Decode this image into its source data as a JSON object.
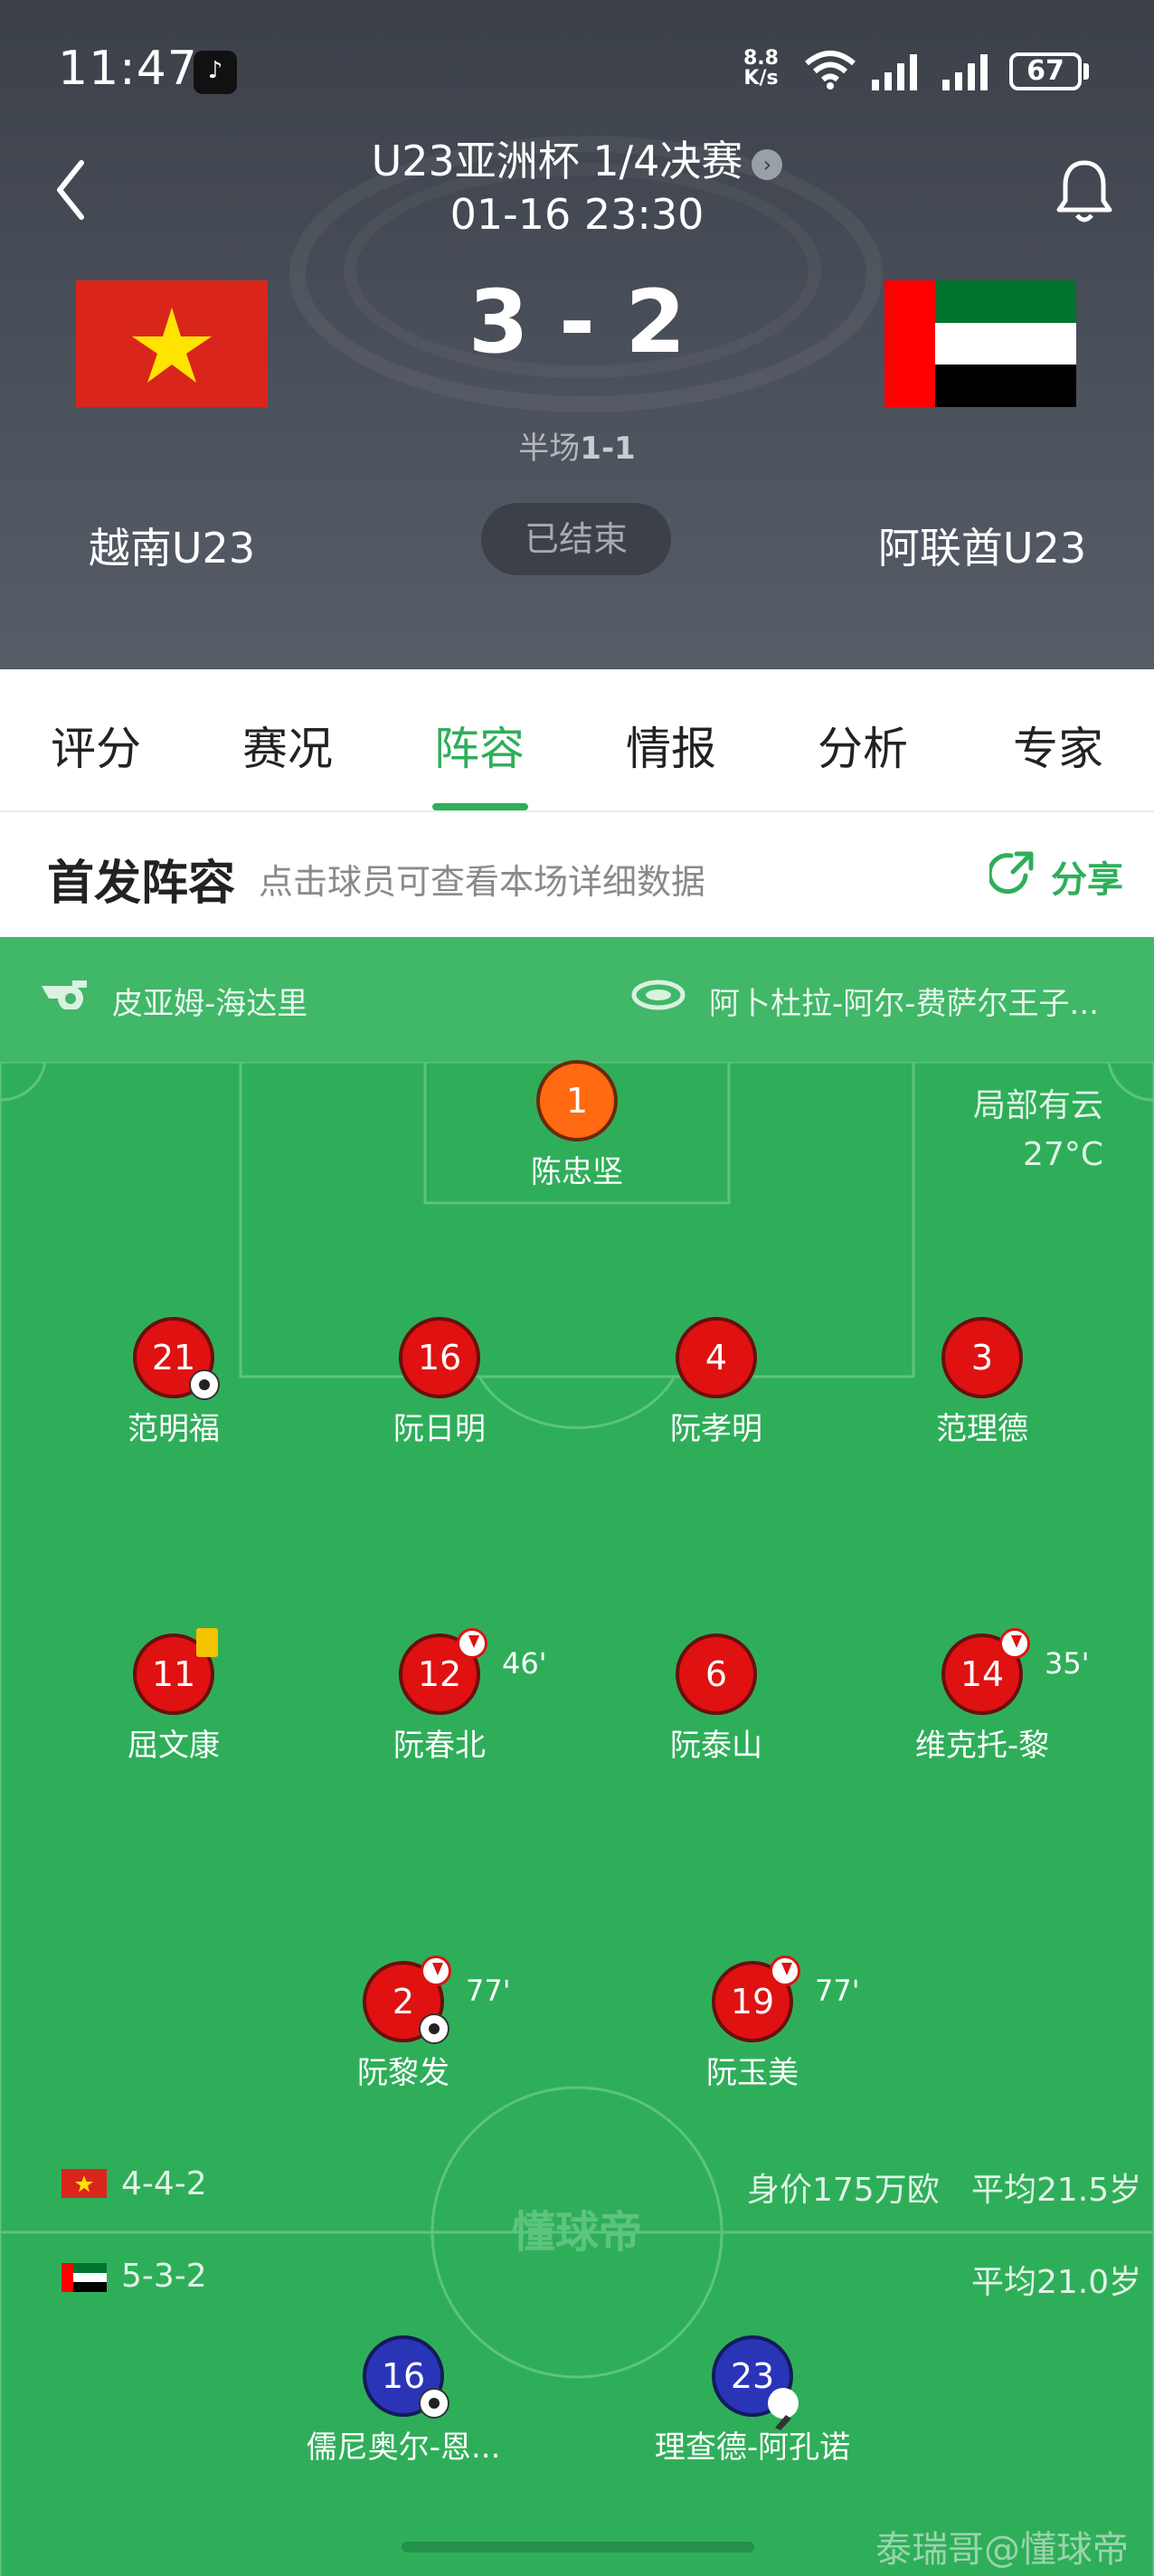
{
  "status_bar": {
    "time": "11:47",
    "net_speed": "8.8",
    "net_unit": "K/s",
    "battery": "67"
  },
  "header": {
    "title": "U23亚洲杯 1/4决赛",
    "datetime": "01-16 23:30",
    "score": "3 - 2",
    "halftime_label": "半场",
    "halftime_score": "1-1",
    "status": "已结束",
    "home_team": "越南U23",
    "away_team": "阿联酋U23"
  },
  "tabs": [
    {
      "label": "评分"
    },
    {
      "label": "赛况"
    },
    {
      "label": "阵容",
      "active": true
    },
    {
      "label": "情报"
    },
    {
      "label": "分析"
    },
    {
      "label": "专家"
    }
  ],
  "lineup": {
    "title": "首发阵容",
    "hint": "点击球员可查看本场详细数据",
    "share_label": "分享",
    "referee": "皮亚姆-海达里",
    "stadium": "阿卜杜拉-阿尔-费萨尔王子...",
    "weather": "局部有云",
    "temperature": "27°C"
  },
  "home_players": [
    {
      "number": "1",
      "name": "陈忠坚",
      "color": "orange"
    },
    {
      "number": "21",
      "name": "范明福",
      "events": [
        "goal"
      ]
    },
    {
      "number": "16",
      "name": "阮日明"
    },
    {
      "number": "4",
      "name": "阮孝明"
    },
    {
      "number": "3",
      "name": "范理德"
    },
    {
      "number": "11",
      "name": "屈文康",
      "events": [
        "yellow"
      ]
    },
    {
      "number": "12",
      "name": "阮春北",
      "events": [
        "sub"
      ],
      "sub_time": "46'"
    },
    {
      "number": "6",
      "name": "阮泰山"
    },
    {
      "number": "14",
      "name": "维克托-黎",
      "events": [
        "sub"
      ],
      "sub_time": "35'"
    },
    {
      "number": "2",
      "name": "阮黎发",
      "events": [
        "sub",
        "goal"
      ],
      "sub_time": "77'"
    },
    {
      "number": "19",
      "name": "阮玉美",
      "events": [
        "sub"
      ],
      "sub_time": "77'"
    }
  ],
  "home_summary": {
    "formation": "4-4-2",
    "value": "身价175万欧",
    "avg_age": "平均21.5岁"
  },
  "away_summary": {
    "formation": "5-3-2",
    "avg_age": "平均21.0岁"
  },
  "away_players": [
    {
      "number": "16",
      "name": "儒尼奥尔-恩...",
      "events": [
        "goal"
      ]
    },
    {
      "number": "23",
      "name": "理查德-阿孔诺",
      "events": [
        "assist"
      ]
    }
  ],
  "center_watermark": "懂球帝",
  "footer_watermark": "泰瑞哥@懂球帝",
  "colors": {
    "accent": "#2fae5a",
    "pitch": "#2fae5a",
    "home": "#e01111",
    "away": "#2a34b7"
  }
}
